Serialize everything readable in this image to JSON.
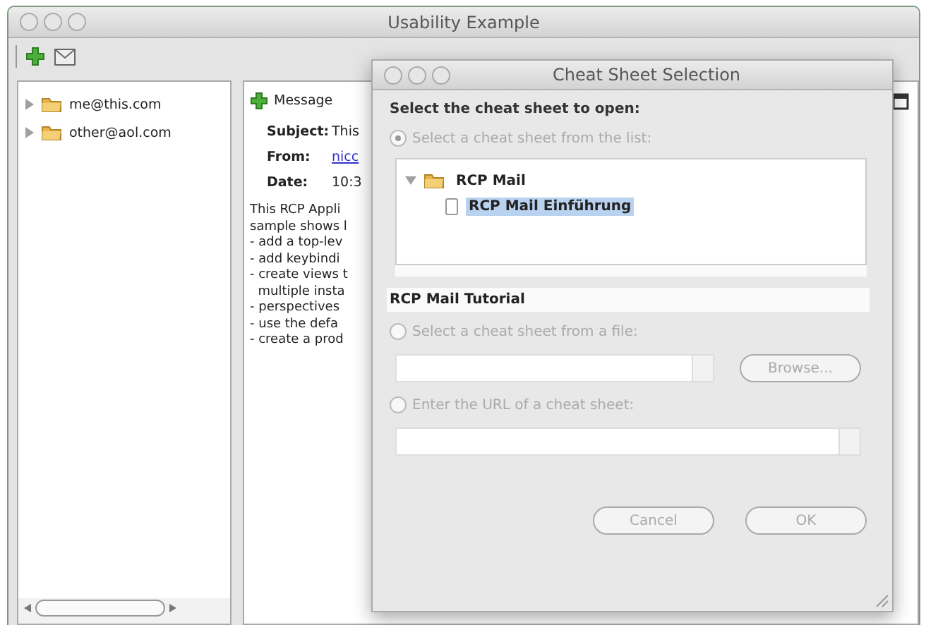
{
  "window": {
    "title": "Usability Example"
  },
  "accounts": [
    {
      "label": "me@this.com",
      "expanded": false
    },
    {
      "label": "other@aol.com",
      "expanded": false
    }
  ],
  "message": {
    "tab": "Message",
    "subject_label": "Subject:",
    "subject": "This",
    "from_label": "From:",
    "from": "nicc",
    "date_label": "Date:",
    "date": "10:3",
    "body": [
      "This RCP Appli",
      "sample shows l",
      "- add a top-lev",
      "- add keybindi",
      "- create views t",
      "  multiple insta",
      "- perspectives",
      "- use the defa",
      "- create a prod"
    ]
  },
  "dialog": {
    "title": "Cheat Sheet Selection",
    "prompt": "Select the cheat sheet to open:",
    "options": [
      {
        "kind": "list",
        "label": "Select a cheat sheet from the list:",
        "selected": true
      },
      {
        "kind": "file",
        "label": "Select a cheat sheet from a file:",
        "selected": false
      },
      {
        "kind": "url",
        "label": "Enter the URL of a cheat sheet:",
        "selected": false
      }
    ],
    "tree": [
      {
        "label": "RCP Mail",
        "expanded": true,
        "selected": false,
        "children": [
          {
            "label": "RCP Mail Einführung",
            "selected": true
          }
        ]
      }
    ],
    "description": "RCP Mail Tutorial",
    "browse": "Browse...",
    "buttons": [
      "Cancel",
      "OK"
    ]
  }
}
